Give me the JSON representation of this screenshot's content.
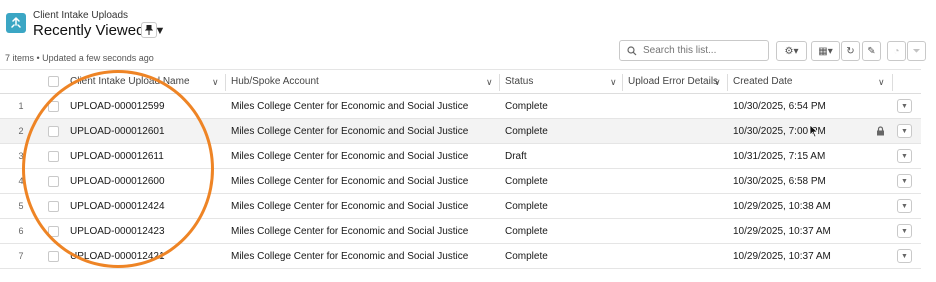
{
  "header": {
    "object_label": "Client Intake Uploads",
    "view_name": "Recently Viewed",
    "meta": "7 items • Updated a few seconds ago",
    "icon": "upload-app-icon"
  },
  "toolbar": {
    "search_placeholder": "Search this list..."
  },
  "table": {
    "columns": [
      "Client Intake Upload Name",
      "Hub/Spoke Account",
      "Status",
      "Upload Error Details",
      "Created Date"
    ],
    "rows": [
      {
        "num": "1",
        "name": "UPLOAD-000012599",
        "account": "Miles College Center for Economic and Social Justice",
        "status": "Complete",
        "created": "10/30/2025, 6:54 PM"
      },
      {
        "num": "2",
        "name": "UPLOAD-000012601",
        "account": "Miles College Center for Economic and Social Justice",
        "status": "Complete",
        "created": "10/30/2025, 7:00 PM"
      },
      {
        "num": "3",
        "name": "UPLOAD-000012611",
        "account": "Miles College Center for Economic and Social Justice",
        "status": "Draft",
        "created": "10/31/2025, 7:15 AM"
      },
      {
        "num": "4",
        "name": "UPLOAD-000012600",
        "account": "Miles College Center for Economic and Social Justice",
        "status": "Complete",
        "created": "10/30/2025, 6:58 PM"
      },
      {
        "num": "5",
        "name": "UPLOAD-000012424",
        "account": "Miles College Center for Economic and Social Justice",
        "status": "Complete",
        "created": "10/29/2025, 10:38 AM"
      },
      {
        "num": "6",
        "name": "UPLOAD-000012423",
        "account": "Miles College Center for Economic and Social Justice",
        "status": "Complete",
        "created": "10/29/2025, 10:37 AM"
      },
      {
        "num": "7",
        "name": "UPLOAD-000012421",
        "account": "Miles College Center for Economic and Social Justice",
        "status": "Complete",
        "created": "10/29/2025, 10:37 AM"
      }
    ]
  },
  "colors": {
    "accent": "#3ba6c4",
    "annotation": "#ee8425",
    "row_highlight": "#f3f3f3"
  }
}
